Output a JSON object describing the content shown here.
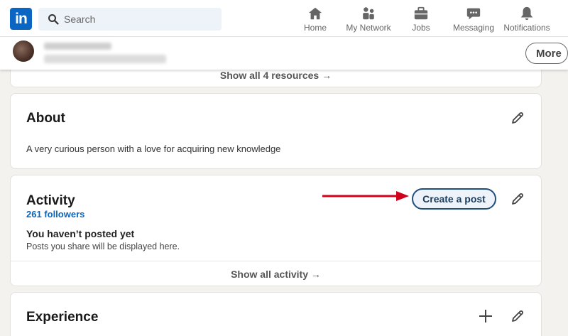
{
  "nav": {
    "logo": "in",
    "search_placeholder": "Search",
    "items": [
      {
        "label": "Home",
        "icon": "home-icon"
      },
      {
        "label": "My Network",
        "icon": "network-icon"
      },
      {
        "label": "Jobs",
        "icon": "briefcase-icon"
      },
      {
        "label": "Messaging",
        "icon": "message-icon"
      },
      {
        "label": "Notifications",
        "icon": "bell-icon"
      }
    ],
    "more_label": "More"
  },
  "resources": {
    "footer_link": "Show all 4 resources →"
  },
  "about": {
    "title": "About",
    "text": "A very curious person with a love for acquiring new knowledge"
  },
  "activity": {
    "title": "Activity",
    "followers": "261 followers",
    "create_post_label": "Create a post",
    "empty_title": "You haven’t posted yet",
    "empty_sub": "Posts you share will be displayed here.",
    "footer_link": "Show all activity →"
  },
  "experience": {
    "title": "Experience"
  },
  "colors": {
    "brand": "#0a66c2",
    "annotation_arrow": "#d0021b"
  }
}
